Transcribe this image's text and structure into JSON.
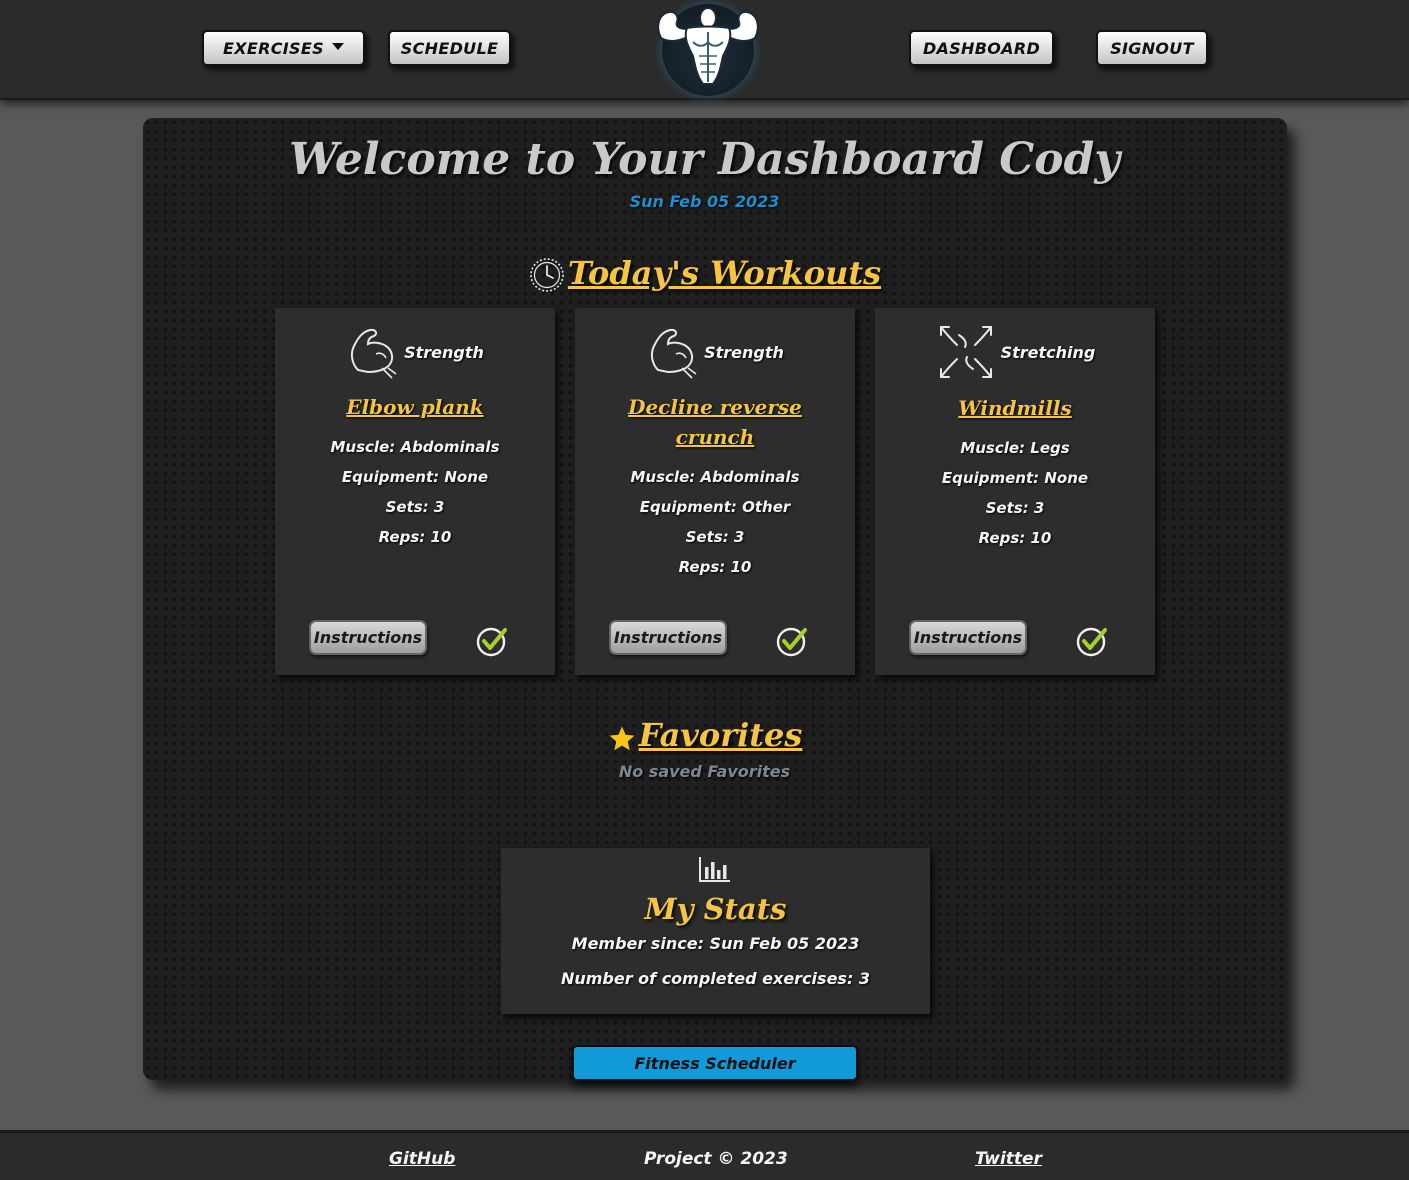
{
  "nav": {
    "exercises_label": "EXERCISES",
    "schedule_label": "SCHEDULE",
    "dashboard_label": "DASHBOARD",
    "signout_label": "SIGNOUT",
    "logo_icon": "bodybuilder-logo-icon"
  },
  "header": {
    "title": "Welcome to Your Dashboard Cody",
    "date": "Sun Feb 05 2023"
  },
  "workouts": {
    "heading": "Today's Workouts",
    "heading_icon": "clock-icon",
    "cards": [
      {
        "type": "Strength",
        "type_icon": "flexed-arm-icon",
        "name": "Elbow plank",
        "muscle": "Muscle: Abdominals",
        "equipment": "Equipment: None",
        "sets": "Sets: 3",
        "reps": "Reps: 10",
        "instructions_label": "Instructions"
      },
      {
        "type": "Strength",
        "type_icon": "flexed-arm-icon",
        "name": "Decline reverse crunch",
        "muscle": "Muscle: Abdominals",
        "equipment": "Equipment: Other",
        "sets": "Sets: 3",
        "reps": "Reps: 10",
        "instructions_label": "Instructions"
      },
      {
        "type": "Stretching",
        "type_icon": "expand-arrows-icon",
        "name": "Windmills",
        "muscle": "Muscle: Legs",
        "equipment": "Equipment: None",
        "sets": "Sets: 3",
        "reps": "Reps: 10",
        "instructions_label": "Instructions"
      }
    ]
  },
  "favorites": {
    "heading": "Favorites",
    "heading_icon": "star-icon",
    "empty_text": "No saved Favorites"
  },
  "stats": {
    "icon": "bar-chart-icon",
    "title": "My Stats",
    "member_since": "Member since: Sun Feb 05 2023",
    "completed": "Number of completed exercises: 3"
  },
  "scheduler_button": "Fitness Scheduler",
  "footer": {
    "github": "GitHub",
    "copyright": "Project © 2023",
    "twitter": "Twitter"
  },
  "colors": {
    "accent_gold": "#f5c443",
    "accent_blue": "#129ad8",
    "check_green": "#a7d129"
  }
}
